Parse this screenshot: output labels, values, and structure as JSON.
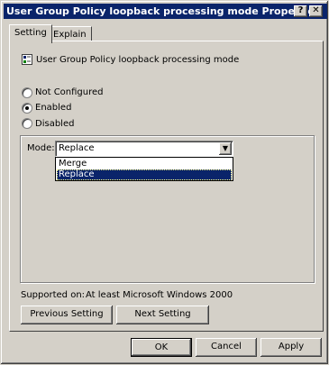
{
  "window": {
    "title": "User Group Policy loopback processing mode Properties",
    "help_button": "?",
    "close_button": "X"
  },
  "tabs": [
    {
      "label": "Setting",
      "active": true
    },
    {
      "label": "Explain",
      "active": false
    }
  ],
  "setting": {
    "policy_name": "User Group Policy loopback processing mode",
    "policy_icon": "policy-setting-icon",
    "options": [
      {
        "label": "Not Configured",
        "selected": false
      },
      {
        "label": "Enabled",
        "selected": true
      },
      {
        "label": "Disabled",
        "selected": false
      }
    ],
    "mode": {
      "label": "Mode:",
      "value": "Replace",
      "options": [
        "Merge",
        "Replace"
      ],
      "highlighted": "Replace"
    },
    "supported_on_label": "Supported on:",
    "supported_on_value": "At least Microsoft Windows 2000",
    "previous_button": "Previous Setting",
    "next_button": "Next Setting"
  },
  "footer": {
    "ok": "OK",
    "cancel": "Cancel",
    "apply": "Apply"
  }
}
